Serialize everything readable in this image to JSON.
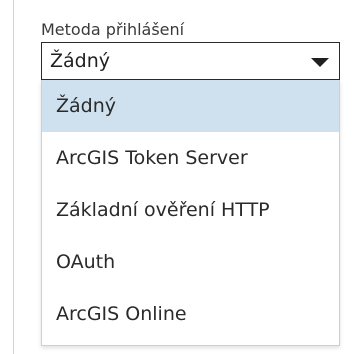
{
  "login_method": {
    "label": "Metoda přihlášení",
    "selected_value": "Žádný",
    "caret_icon": "chevron-down-icon",
    "options": [
      {
        "label": "Žádný",
        "selected": true
      },
      {
        "label": "ArcGIS Token Server",
        "selected": false
      },
      {
        "label": "Základní ověření HTTP",
        "selected": false
      },
      {
        "label": "OAuth",
        "selected": false
      },
      {
        "label": "ArcGIS Online",
        "selected": false
      }
    ]
  },
  "colors": {
    "selected_option_bg": "#cfe1ef",
    "border": "#2b2b2b",
    "text": "#2a2a2a"
  }
}
